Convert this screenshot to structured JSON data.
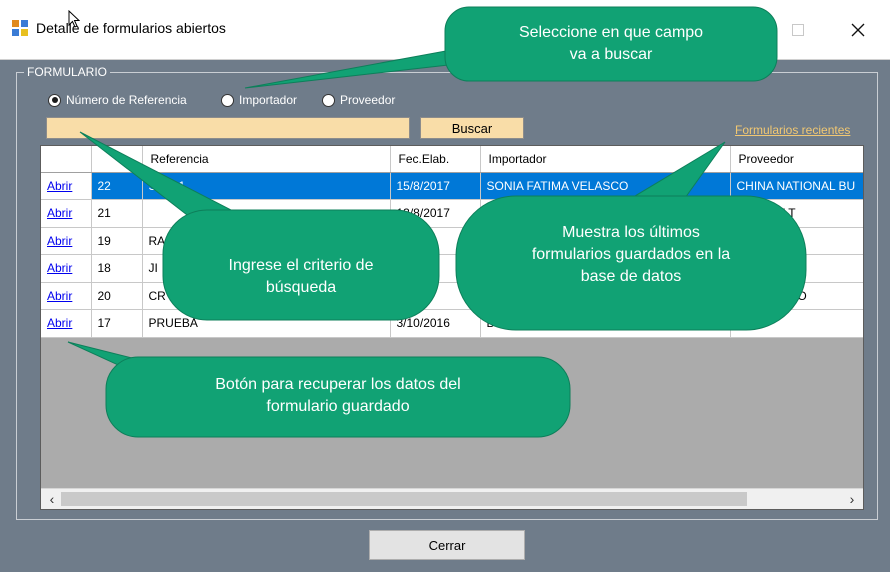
{
  "window": {
    "title": "Detalle de formularios abiertos"
  },
  "group": {
    "label": "FORMULARIO"
  },
  "search_by": {
    "options": [
      {
        "label": "Número de Referencia",
        "checked": true
      },
      {
        "label": "Importador",
        "checked": false
      },
      {
        "label": "Proveedor",
        "checked": false
      }
    ]
  },
  "search": {
    "value": "",
    "button_label": "Buscar"
  },
  "recent_link": "Formularios recientes",
  "grid": {
    "columns": [
      "",
      "",
      "Referencia",
      "Fec.Elab.",
      "Importador",
      "Proveedor"
    ],
    "rows": [
      {
        "action": "Abrir",
        "id": "22",
        "referencia": "SFV01",
        "fecha": "15/8/2017",
        "importador": "SONIA FATIMA VELASCO",
        "proveedor": "CHINA NATIONAL BU",
        "selected": true
      },
      {
        "action": "Abrir",
        "id": "21",
        "referencia": "",
        "fecha": "13/8/2017",
        "importador": "",
        "proveedor": "HEBRO LT",
        "selected": false
      },
      {
        "action": "Abrir",
        "id": "19",
        "referencia": "RA",
        "fecha": "201",
        "importador": "",
        "proveedor": "IMPORT A",
        "selected": false
      },
      {
        "action": "Abrir",
        "id": "18",
        "referencia": "JI",
        "fecha": "201",
        "importador": "",
        "proveedor": "DING (YIW",
        "selected": false
      },
      {
        "action": "Abrir",
        "id": "20",
        "referencia": "CR",
        "fecha": "2017",
        "importador": "",
        "proveedor": "EXPORT RO",
        "selected": false
      },
      {
        "action": "Abrir",
        "id": "17",
        "referencia": "PRUEBA",
        "fecha": "3/10/2016",
        "importador": "D",
        "proveedor": "",
        "selected": false
      }
    ]
  },
  "scroll": {
    "left_icon": "chevron-left-icon",
    "right_icon": "chevron-right-icon"
  },
  "close_button": "Cerrar",
  "callouts": {
    "field": [
      "Seleccione en que  campo",
      "va a buscar"
    ],
    "criteria": [
      "Ingrese el criterio de",
      "búsqueda"
    ],
    "recent": [
      "Muestra los últimos",
      "formularios guardados en la",
      "base de datos"
    ],
    "open_button": [
      "Botón para recuperar los datos del",
      "formulario guardado"
    ]
  },
  "colors": {
    "background": "#6f7c8a",
    "callout": "#11a274",
    "input_highlight": "#f9dda8",
    "selection": "#0078d7",
    "link_recent": "#f2c872"
  }
}
